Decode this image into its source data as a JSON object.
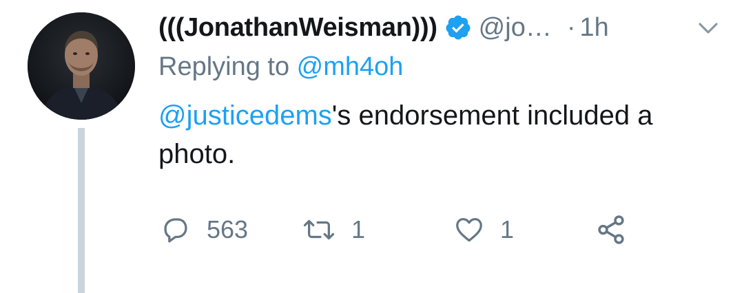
{
  "tweet": {
    "display_name": "(((JonathanWeisman)))",
    "handle": "@jo…",
    "separator": "·",
    "time": "1h",
    "replying_prefix": "Replying to ",
    "replying_to": "@mh4oh",
    "body_mention": "@justicedems",
    "body_rest": "'s endorsement included a photo.",
    "avatar_icon": "profile-photo",
    "verified_icon": "verified-badge-icon",
    "more_icon": "chevron-down-icon"
  },
  "actions": {
    "reply": {
      "icon": "reply-icon",
      "count": "563"
    },
    "retweet": {
      "icon": "retweet-icon",
      "count": "1"
    },
    "like": {
      "icon": "heart-icon",
      "count": "1"
    },
    "share": {
      "icon": "share-icon"
    }
  },
  "colors": {
    "link": "#1da1f2",
    "muted": "#657786",
    "text": "#14171a",
    "thread_line": "#c9d4dc",
    "verified": "#1da1f2"
  }
}
